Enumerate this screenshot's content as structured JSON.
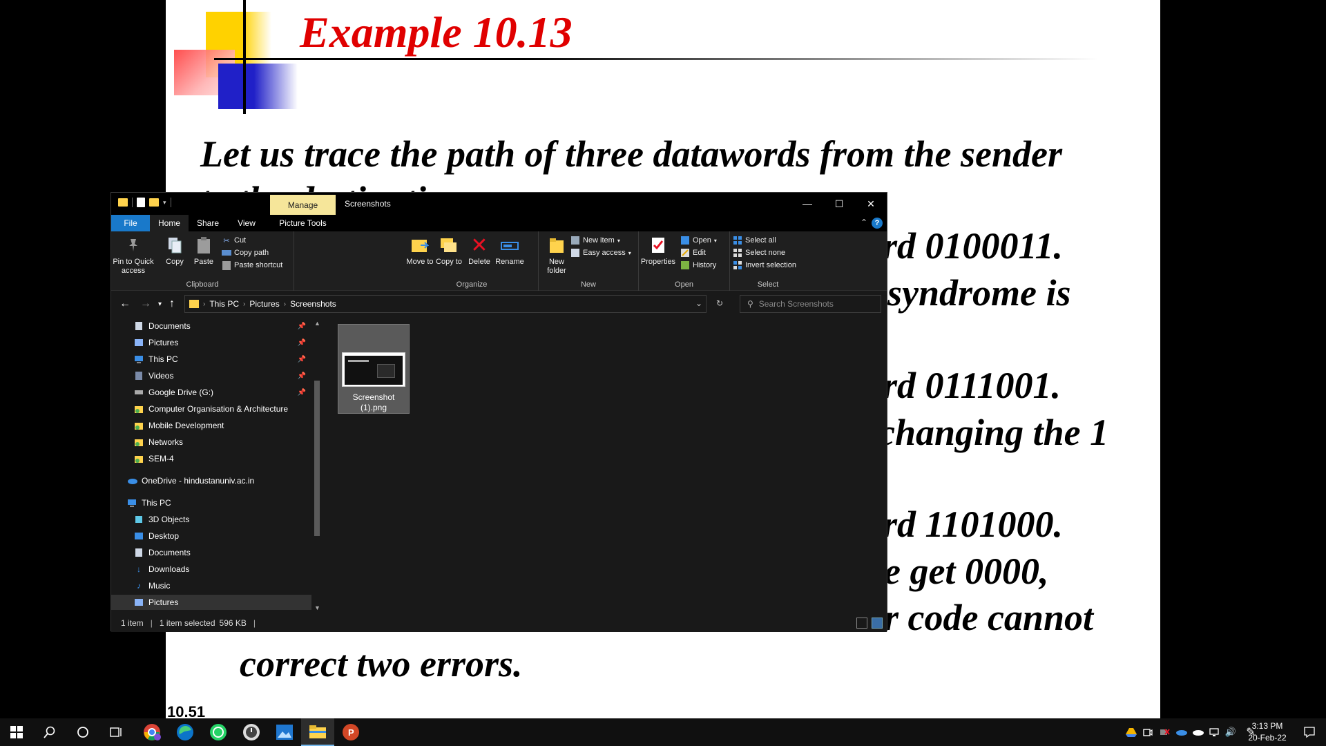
{
  "slide": {
    "title": "Example 10.13",
    "lines": [
      "Let us trace the path of three datawords from the sender",
      "to the destination:",
      "rd 0100011.",
      "syndrome is",
      "rd 0111001.",
      "changing the 1",
      "rd 1101000.",
      "e get 0000,",
      "r code cannot",
      "correct two errors."
    ],
    "page_number": "10.51"
  },
  "explorer": {
    "window_title": "Screenshots",
    "context_tab": "Manage",
    "tabs": {
      "file": "File",
      "home": "Home",
      "share": "Share",
      "view": "View",
      "picture_tools": "Picture Tools"
    },
    "ribbon": {
      "clipboard": {
        "label": "Clipboard",
        "pin": "Pin to Quick access",
        "copy": "Copy",
        "paste": "Paste",
        "cut": "Cut",
        "copy_path": "Copy path",
        "paste_shortcut": "Paste shortcut"
      },
      "organize": {
        "label": "Organize",
        "move_to": "Move to",
        "copy_to": "Copy to",
        "delete": "Delete",
        "rename": "Rename"
      },
      "new": {
        "label": "New",
        "new_folder": "New folder",
        "new_item": "New item",
        "easy_access": "Easy access"
      },
      "open": {
        "label": "Open",
        "properties": "Properties",
        "open": "Open",
        "edit": "Edit",
        "history": "History"
      },
      "select": {
        "label": "Select",
        "select_all": "Select all",
        "select_none": "Select none",
        "invert": "Invert selection"
      }
    },
    "address": {
      "crumbs": [
        "This PC",
        "Pictures",
        "Screenshots"
      ],
      "search_placeholder": "Search Screenshots"
    },
    "nav": {
      "quick": [
        "Documents",
        "Pictures",
        "This PC",
        "Videos",
        "Google Drive (G:)",
        "Computer Organisation & Architecture",
        "Mobile Development",
        "Networks",
        "SEM-4"
      ],
      "onedrive": "OneDrive - hindustanuniv.ac.in",
      "this_pc": "This PC",
      "pc_items": [
        "3D Objects",
        "Desktop",
        "Documents",
        "Downloads",
        "Music",
        "Pictures"
      ]
    },
    "file": {
      "name": "Screenshot (1).png"
    },
    "status": {
      "count": "1 item",
      "selected": "1 item selected",
      "size": "596 KB"
    }
  },
  "taskbar": {
    "time": "3:13 PM",
    "date": "20-Feb-22",
    "accent": "#76b9ed"
  }
}
